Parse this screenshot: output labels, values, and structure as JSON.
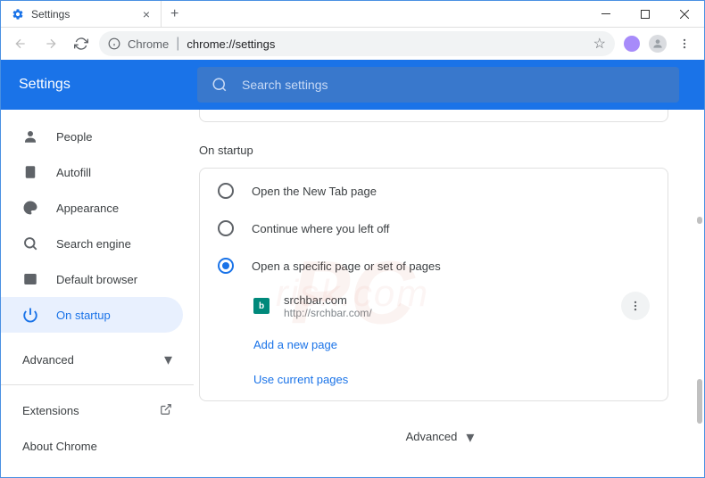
{
  "window": {
    "tab_title": "Settings",
    "address_prefix": "Chrome",
    "address_path": "chrome://settings"
  },
  "header": {
    "title": "Settings",
    "search_placeholder": "Search settings"
  },
  "sidebar": {
    "items": [
      {
        "label": "People"
      },
      {
        "label": "Autofill"
      },
      {
        "label": "Appearance"
      },
      {
        "label": "Search engine"
      },
      {
        "label": "Default browser"
      },
      {
        "label": "On startup"
      }
    ],
    "advanced": "Advanced",
    "extensions": "Extensions",
    "about": "About Chrome"
  },
  "content": {
    "section_title": "On startup",
    "options": [
      {
        "label": "Open the New Tab page"
      },
      {
        "label": "Continue where you left off"
      },
      {
        "label": "Open a specific page or set of pages"
      }
    ],
    "page": {
      "name": "srchbar.com",
      "url": "http://srchbar.com/"
    },
    "add_link": "Add a new page",
    "use_current": "Use current pages",
    "bottom_advanced": "Advanced"
  }
}
